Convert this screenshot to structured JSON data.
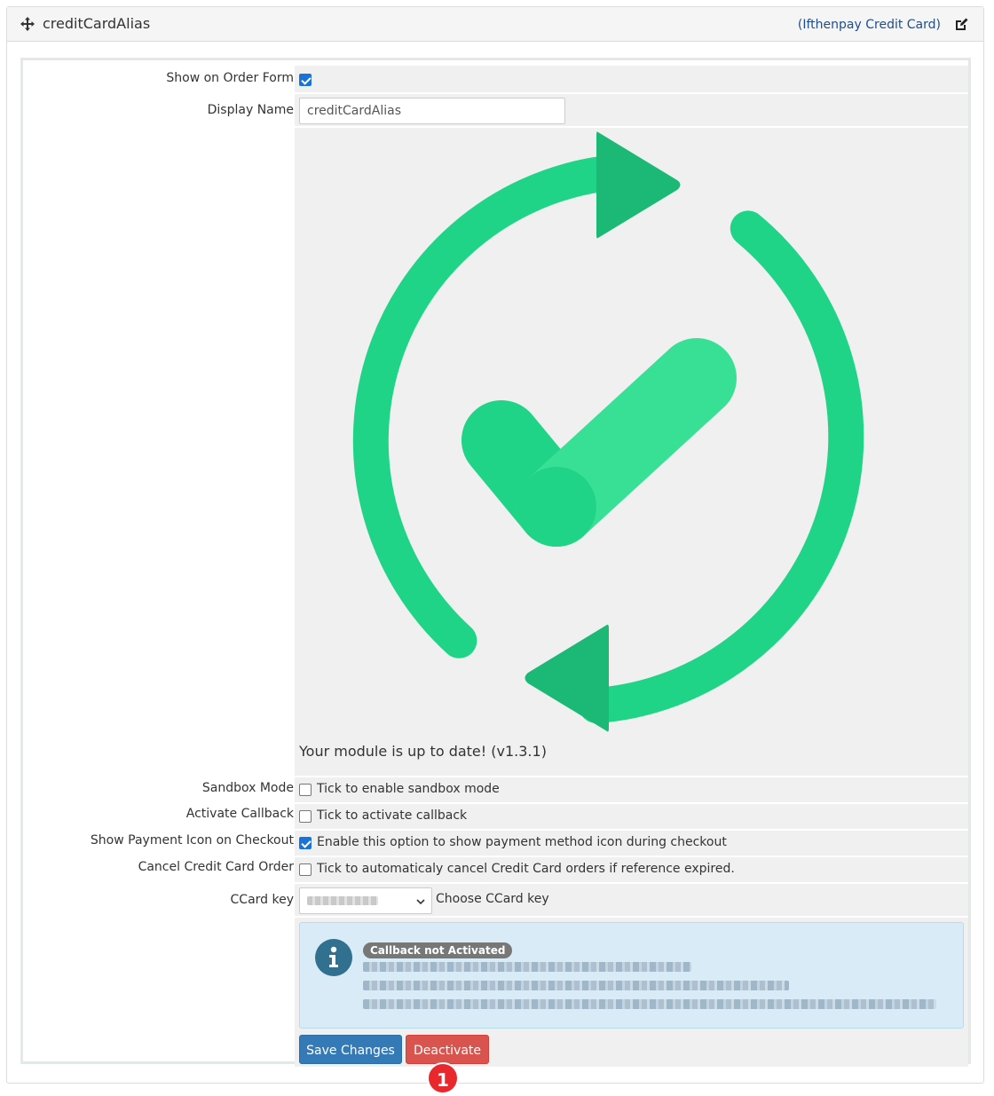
{
  "header": {
    "module_name": "creditCardAlias",
    "gateway_label": "(Ifthenpay Credit Card)"
  },
  "form": {
    "show_on_order_form": {
      "label": "Show on Order Form",
      "checked": true
    },
    "display_name": {
      "label": "Display Name",
      "value": "creditCardAlias"
    },
    "update_status": "Your module is up to date! (v1.3.1)",
    "sandbox_mode": {
      "label": "Sandbox Mode",
      "checked": false,
      "text": "Tick to enable sandbox mode"
    },
    "activate_callback": {
      "label": "Activate Callback",
      "checked": false,
      "text": "Tick to activate callback"
    },
    "show_payment_icon": {
      "label": "Show Payment Icon on Checkout",
      "checked": true,
      "text": "Enable this option to show payment method icon during checkout"
    },
    "cancel_order": {
      "label": "Cancel Credit Card Order",
      "checked": false,
      "text": "Tick to automaticaly cancel Credit Card orders if reference expired."
    },
    "ccard_key": {
      "label": "CCard key",
      "help": "Choose CCard key"
    },
    "callback_alert": {
      "badge": "Callback not Activated"
    },
    "save_label": "Save Changes",
    "deactivate_label": "Deactivate"
  },
  "step_marker": "1",
  "colors": {
    "primary": "#337ab7",
    "danger": "#d9534f",
    "success_green": "#20d487",
    "success_green_dark": "#1bb876",
    "alert_bg": "#d9ebf6",
    "marker_red": "#e8282d"
  },
  "icons": {
    "move": "move-icon",
    "edit": "edit-icon",
    "update": "sync-check-icon",
    "info": "info-icon"
  }
}
